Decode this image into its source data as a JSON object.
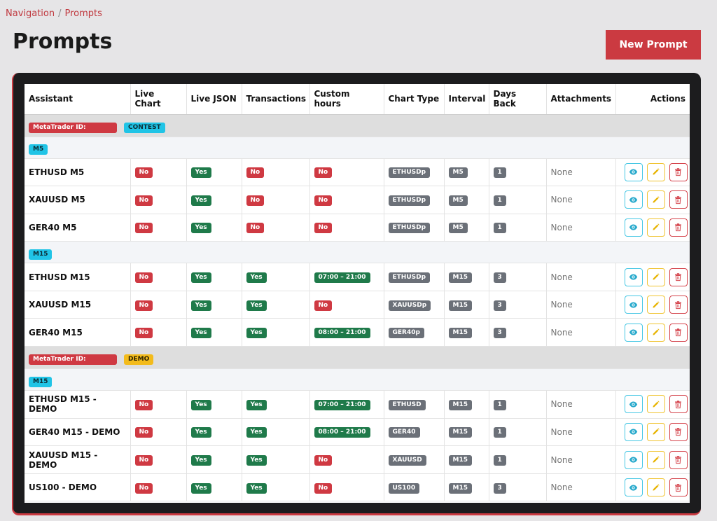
{
  "breadcrumb": {
    "parent": "Navigation",
    "separator": "/",
    "current": "Prompts"
  },
  "page": {
    "title": "Prompts",
    "new_button": "New Prompt"
  },
  "table": {
    "headers": [
      "Assistant",
      "Live Chart",
      "Live JSON",
      "Transactions",
      "Custom hours",
      "Chart Type",
      "Interval",
      "Days Back",
      "Attachments",
      "Actions"
    ],
    "groups": [
      {
        "mt_label": "MetaTrader ID:",
        "account_type": "CONTEST",
        "intervals": [
          {
            "label": "M5",
            "rows": [
              {
                "name": "ETHUSD M5",
                "live_chart": "No",
                "live_json": "Yes",
                "transactions": "No",
                "custom_hours": "No",
                "chart_type": "ETHUSDp",
                "interval": "M5",
                "days_back": "1",
                "attachments": "None"
              },
              {
                "name": "XAUUSD M5",
                "live_chart": "No",
                "live_json": "Yes",
                "transactions": "No",
                "custom_hours": "No",
                "chart_type": "ETHUSDp",
                "interval": "M5",
                "days_back": "1",
                "attachments": "None"
              },
              {
                "name": "GER40 M5",
                "live_chart": "No",
                "live_json": "Yes",
                "transactions": "No",
                "custom_hours": "No",
                "chart_type": "ETHUSDp",
                "interval": "M5",
                "days_back": "1",
                "attachments": "None"
              }
            ]
          },
          {
            "label": "M15",
            "rows": [
              {
                "name": "ETHUSD M15",
                "live_chart": "No",
                "live_json": "Yes",
                "transactions": "Yes",
                "custom_hours": "07:00 – 21:00",
                "chart_type": "ETHUSDp",
                "interval": "M15",
                "days_back": "3",
                "attachments": "None"
              },
              {
                "name": "XAUUSD M15",
                "live_chart": "No",
                "live_json": "Yes",
                "transactions": "Yes",
                "custom_hours": "No",
                "chart_type": "XAUUSDp",
                "interval": "M15",
                "days_back": "3",
                "attachments": "None"
              },
              {
                "name": "GER40 M15",
                "live_chart": "No",
                "live_json": "Yes",
                "transactions": "Yes",
                "custom_hours": "08:00 – 21:00",
                "chart_type": "GER40p",
                "interval": "M15",
                "days_back": "3",
                "attachments": "None"
              }
            ]
          }
        ]
      },
      {
        "mt_label": "MetaTrader ID:",
        "account_type": "DEMO",
        "intervals": [
          {
            "label": "M15",
            "rows": [
              {
                "name": "ETHUSD M15 - DEMO",
                "live_chart": "No",
                "live_json": "Yes",
                "transactions": "Yes",
                "custom_hours": "07:00 – 21:00",
                "chart_type": "ETHUSD",
                "interval": "M15",
                "days_back": "1",
                "attachments": "None"
              },
              {
                "name": "GER40 M15 - DEMO",
                "live_chart": "No",
                "live_json": "Yes",
                "transactions": "Yes",
                "custom_hours": "08:00 – 21:00",
                "chart_type": "GER40",
                "interval": "M15",
                "days_back": "1",
                "attachments": "None"
              },
              {
                "name": "XAUUSD M15 - DEMO",
                "live_chart": "No",
                "live_json": "Yes",
                "transactions": "Yes",
                "custom_hours": "No",
                "chart_type": "XAUUSD",
                "interval": "M15",
                "days_back": "1",
                "attachments": "None"
              },
              {
                "name": "US100 - DEMO",
                "live_chart": "No",
                "live_json": "Yes",
                "transactions": "Yes",
                "custom_hours": "No",
                "chart_type": "US100",
                "interval": "M15",
                "days_back": "3",
                "attachments": "None"
              }
            ]
          }
        ]
      }
    ]
  },
  "colors": {
    "accent_red": "#cb3a41",
    "badge_green": "#1f7a4a",
    "badge_gray": "#6b7078",
    "badge_cyan": "#20c4e6",
    "badge_yellow": "#f3bb1b"
  },
  "icons": {
    "view": "eye-icon",
    "edit": "pencil-icon",
    "delete": "trash-icon"
  }
}
